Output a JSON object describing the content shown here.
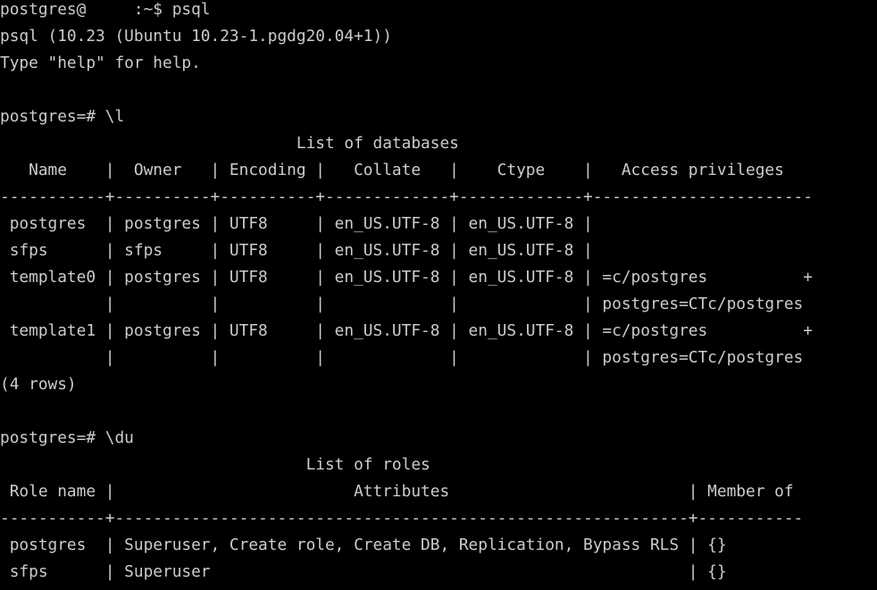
{
  "terminal": {
    "text_color": "#cccccc",
    "background_color": "#000000",
    "lines": [
      "postgres@     :~$ psql",
      "psql (10.23 (Ubuntu 10.23-1.pgdg20.04+1))",
      "Type \"help\" for help.",
      "",
      "postgres=# \\l",
      "                               List of databases",
      "   Name    |  Owner   | Encoding |   Collate   |    Ctype    |   Access privileges",
      "-----------+----------+----------+-------------+-------------+-----------------------",
      " postgres  | postgres | UTF8     | en_US.UTF-8 | en_US.UTF-8 |",
      " sfps      | sfps     | UTF8     | en_US.UTF-8 | en_US.UTF-8 |",
      " template0 | postgres | UTF8     | en_US.UTF-8 | en_US.UTF-8 | =c/postgres          +",
      "           |          |          |             |             | postgres=CTc/postgres",
      " template1 | postgres | UTF8     | en_US.UTF-8 | en_US.UTF-8 | =c/postgres          +",
      "           |          |          |             |             | postgres=CTc/postgres",
      "(4 rows)",
      "",
      "postgres=# \\du",
      "                                List of roles",
      " Role name |                         Attributes                         | Member of",
      "-----------+------------------------------------------------------------+-----------",
      " postgres  | Superuser, Create role, Create DB, Replication, Bypass RLS | {}",
      " sfps      | Superuser                                                  | {}"
    ]
  }
}
